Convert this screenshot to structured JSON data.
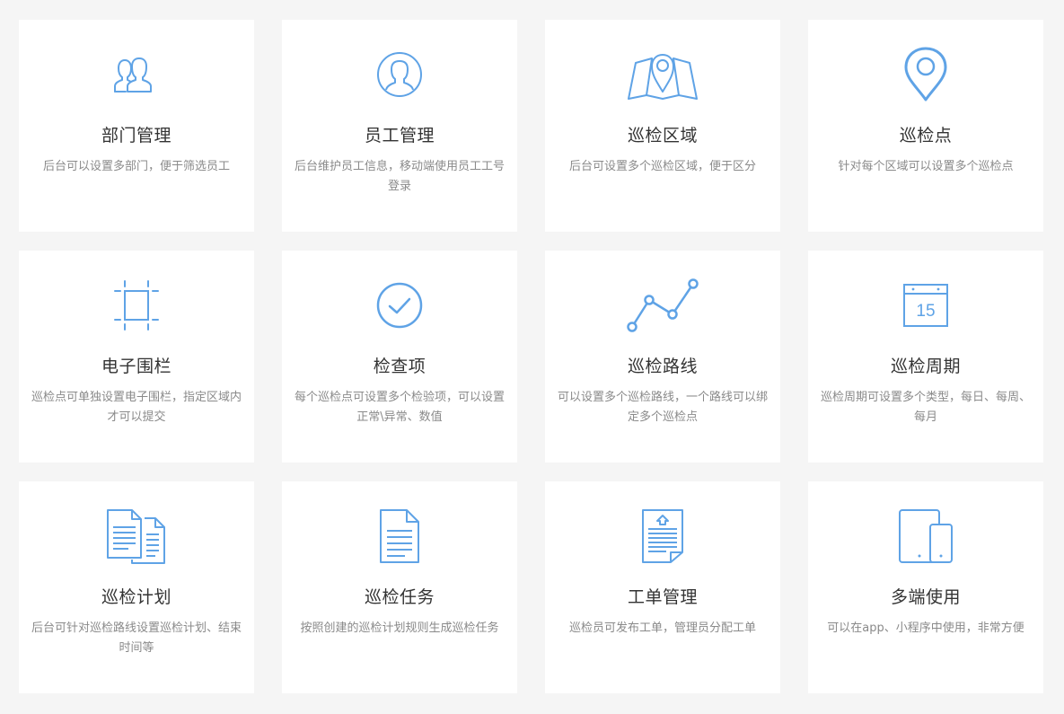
{
  "theme": {
    "icon_color": "#5fa3e6",
    "card_background": "#ffffff",
    "page_background": "#f5f5f5"
  },
  "features": [
    {
      "icon": "users-icon",
      "title": "部门管理",
      "desc": "后台可以设置多部门，便于筛选员工"
    },
    {
      "icon": "user-avatar-icon",
      "title": "员工管理",
      "desc": "后台维护员工信息，移动端使用员工工号登录"
    },
    {
      "icon": "map-area-icon",
      "title": "巡检区域",
      "desc": "后台可设置多个巡检区域，便于区分"
    },
    {
      "icon": "location-pin-icon",
      "title": "巡检点",
      "desc": "针对每个区域可以设置多个巡检点"
    },
    {
      "icon": "fence-frame-icon",
      "title": "电子围栏",
      "desc": "巡检点可单独设置电子围栏，指定区域内才可以提交"
    },
    {
      "icon": "check-circle-icon",
      "title": "检查项",
      "desc": "每个巡检点可设置多个检验项，可以设置正常\\异常、数值"
    },
    {
      "icon": "route-line-icon",
      "title": "巡检路线",
      "desc": "可以设置多个巡检路线，一个路线可以绑定多个巡检点"
    },
    {
      "icon": "calendar-icon",
      "calendar_day": "15",
      "title": "巡检周期",
      "desc": "巡检周期可设置多个类型，每日、每周、每月"
    },
    {
      "icon": "documents-icon",
      "title": "巡检计划",
      "desc": "后台可针对巡检路线设置巡检计划、结束时间等"
    },
    {
      "icon": "document-icon",
      "title": "巡检任务",
      "desc": "按照创建的巡检计划规则生成巡检任务"
    },
    {
      "icon": "work-order-icon",
      "title": "工单管理",
      "desc": "巡检员可发布工单，管理员分配工单"
    },
    {
      "icon": "multi-device-icon",
      "title": "多端使用",
      "desc": "可以在app、小程序中使用，非常方便"
    }
  ]
}
